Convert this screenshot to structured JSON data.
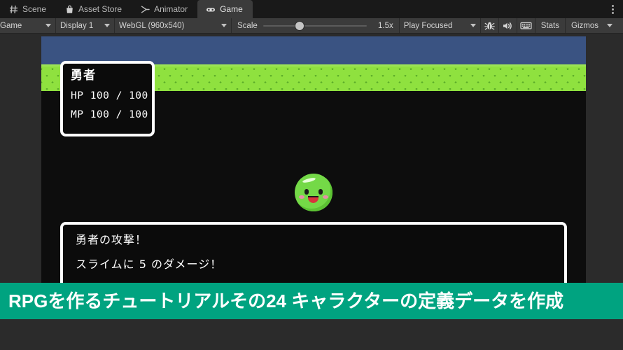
{
  "window": {
    "tabs": [
      {
        "label": "Scene",
        "icon": "grid-icon",
        "active": false
      },
      {
        "label": "Asset Store",
        "icon": "shopping-bag-icon",
        "active": false
      },
      {
        "label": "Animator",
        "icon": "animator-icon",
        "active": false
      },
      {
        "label": "Game",
        "icon": "gamepad-icon",
        "active": true
      }
    ],
    "overflow_menu": "kebab-menu-icon"
  },
  "toolbar": {
    "view_selector": "Game",
    "display_selector": "Display 1",
    "resolution_selector": "WebGL (960x540)",
    "scale_label": "Scale",
    "scale_value": "1.5x",
    "scale_position_percent": 31,
    "play_mode": "Play Focused",
    "mute_audio_icon": "speaker-icon",
    "debug_icon": "bug-icon",
    "stats_icon": "stats-grid-icon",
    "stats_label": "Stats",
    "gizmos_label": "Gizmos"
  },
  "game": {
    "status_window": {
      "name": "勇者",
      "hp": "HP 100 / 100",
      "mp": "MP 100 / 100"
    },
    "enemy": {
      "name": "slime-sprite",
      "body_color": "#74d947",
      "cheek_color": "#f08ab0",
      "mouth_color": "#d8343c"
    },
    "message_window": {
      "line1": "勇者の攻撃！",
      "line2": "スライムに 5 のダメージ！"
    },
    "colors": {
      "sky": "#3a5382",
      "grass": "#8fe13f",
      "grass_detail": "#5fb02a",
      "background": "#0d0d0d"
    }
  },
  "banner": {
    "text": "RPGを作るチュートリアルその24 キャラクターの定義データを作成",
    "background_color": "#00a380",
    "text_color": "#ffffff"
  }
}
